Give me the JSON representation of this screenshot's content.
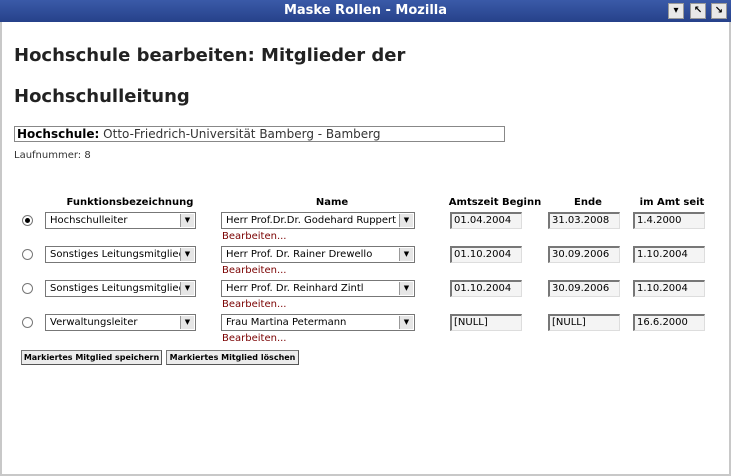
{
  "window": {
    "title": "Maske Rollen - Mozilla"
  },
  "page": {
    "heading_line1": "Hochschule bearbeiten: Mitglieder der",
    "heading_line2": "Hochschulleitung",
    "hochschule_label": "Hochschule:",
    "hochschule_value": "Otto-Friedrich-Universität Bamberg - Bamberg",
    "laufnummer": "Laufnummer: 8"
  },
  "table": {
    "headers": {
      "funktion": "Funktionsbezeichnung",
      "name": "Name",
      "beginn": "Amtszeit Beginn",
      "ende": "Ende",
      "seit": "im Amt seit"
    },
    "link_label": "Bearbeiten...",
    "rows": [
      {
        "selected": true,
        "funktion": "Hochschulleiter",
        "name": "Herr Prof.Dr.Dr. Godehard Ruppert",
        "beginn": "01.04.2004",
        "ende": "31.03.2008",
        "seit": "1.4.2000"
      },
      {
        "selected": false,
        "funktion": "Sonstiges Leitungsmitglied",
        "name": "Herr Prof. Dr. Rainer Drewello",
        "beginn": "01.10.2004",
        "ende": "30.09.2006",
        "seit": "1.10.2004"
      },
      {
        "selected": false,
        "funktion": "Sonstiges Leitungsmitglied",
        "name": "Herr Prof. Dr. Reinhard Zintl",
        "beginn": "01.10.2004",
        "ende": "30.09.2006",
        "seit": "1.10.2004"
      },
      {
        "selected": false,
        "funktion": "Verwaltungsleiter",
        "name": "Frau Martina Petermann",
        "beginn": "[NULL]",
        "ende": "[NULL]",
        "seit": "16.6.2000"
      }
    ]
  },
  "buttons": {
    "save": "Markiertes Mitglied speichern",
    "delete": "Markiertes Mitglied löschen"
  }
}
